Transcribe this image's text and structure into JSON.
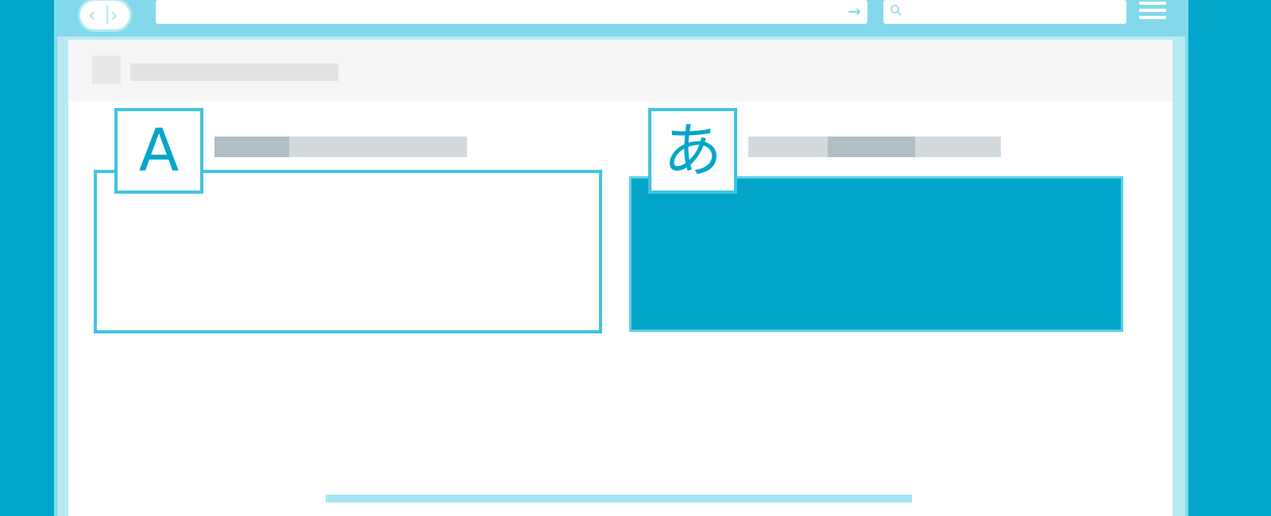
{
  "browser": {
    "nav": {
      "back_icon": "chevron-left-icon",
      "forward_icon": "chevron-right-icon",
      "back_glyph": "‹",
      "forward_glyph": "›"
    },
    "address_bar": {
      "value": "",
      "go_icon": "arrow-right-icon",
      "go_glyph": "→"
    },
    "search_bar": {
      "value": "",
      "icon": "search-icon"
    },
    "menu_icon": "hamburger-menu-icon"
  },
  "page": {
    "header": {
      "logo_icon": "logo-placeholder",
      "title": ""
    },
    "panels": [
      {
        "id": "source",
        "glyph": "A",
        "label": "",
        "state": "empty-outline"
      },
      {
        "id": "target",
        "glyph": "あ",
        "label": "",
        "state": "filled"
      }
    ]
  },
  "colors": {
    "background": "#03a6cb",
    "accent": "#3fc4df",
    "filled_panel": "#02a5ca",
    "placeholder_light": "#d3dadd",
    "placeholder_dark": "#b1bec4"
  }
}
